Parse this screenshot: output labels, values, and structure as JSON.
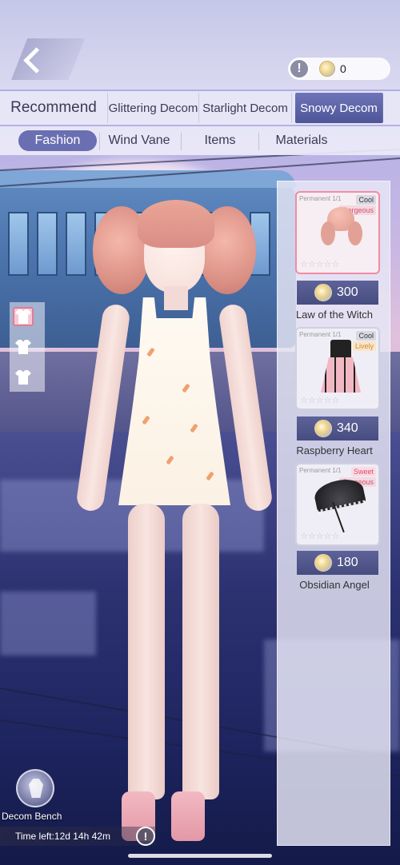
{
  "header": {
    "back_icon": "chevron-left-icon",
    "currency": {
      "info_icon": "exclamation-icon",
      "coin_icon": "coin-icon",
      "value": "0"
    }
  },
  "tabs": [
    {
      "label": "Recommend",
      "active": false
    },
    {
      "label": "Glittering Decom",
      "active": false
    },
    {
      "label": "Starlight Decom",
      "active": false
    },
    {
      "label": "Snowy Decom",
      "active": true
    }
  ],
  "subtabs": [
    {
      "label": "Fashion",
      "active": true
    },
    {
      "label": "Wind Vane",
      "active": false
    },
    {
      "label": "Items",
      "active": false
    },
    {
      "label": "Materials",
      "active": false
    }
  ],
  "swatches": [
    {
      "color": "#e9a5b2",
      "selected": true
    },
    {
      "color": "#e8e8f0",
      "selected": false
    },
    {
      "color": "#e8e8f0",
      "selected": false
    }
  ],
  "shop_items": [
    {
      "permanent": "Permanent 1/1",
      "tag1": "Cool",
      "tag2": "Gorgeous",
      "price": "300",
      "name": "Law of the Witch",
      "stars": "☆☆☆☆☆",
      "selected": true
    },
    {
      "permanent": "Permanent 1/1",
      "tag1": "Cool",
      "tag2": "Lively",
      "price": "340",
      "name": "Raspberry Heart",
      "stars": "☆☆☆☆☆",
      "selected": false
    },
    {
      "permanent": "Permanent 1/1",
      "tag1": "Sweet",
      "tag2": "Gorgeous",
      "price": "180",
      "name": "Obsidian Angel",
      "stars": "☆☆☆☆☆",
      "selected": false
    }
  ],
  "bench": {
    "label": "Decom Bench",
    "icon": "decom-bench-icon"
  },
  "timer": {
    "text": "Time left:12d 14h 42m",
    "info_icon": "exclamation-icon"
  },
  "colors": {
    "accent": "#5d6298",
    "tab_active": "#4e5597",
    "selected_border": "#f28ba6"
  }
}
